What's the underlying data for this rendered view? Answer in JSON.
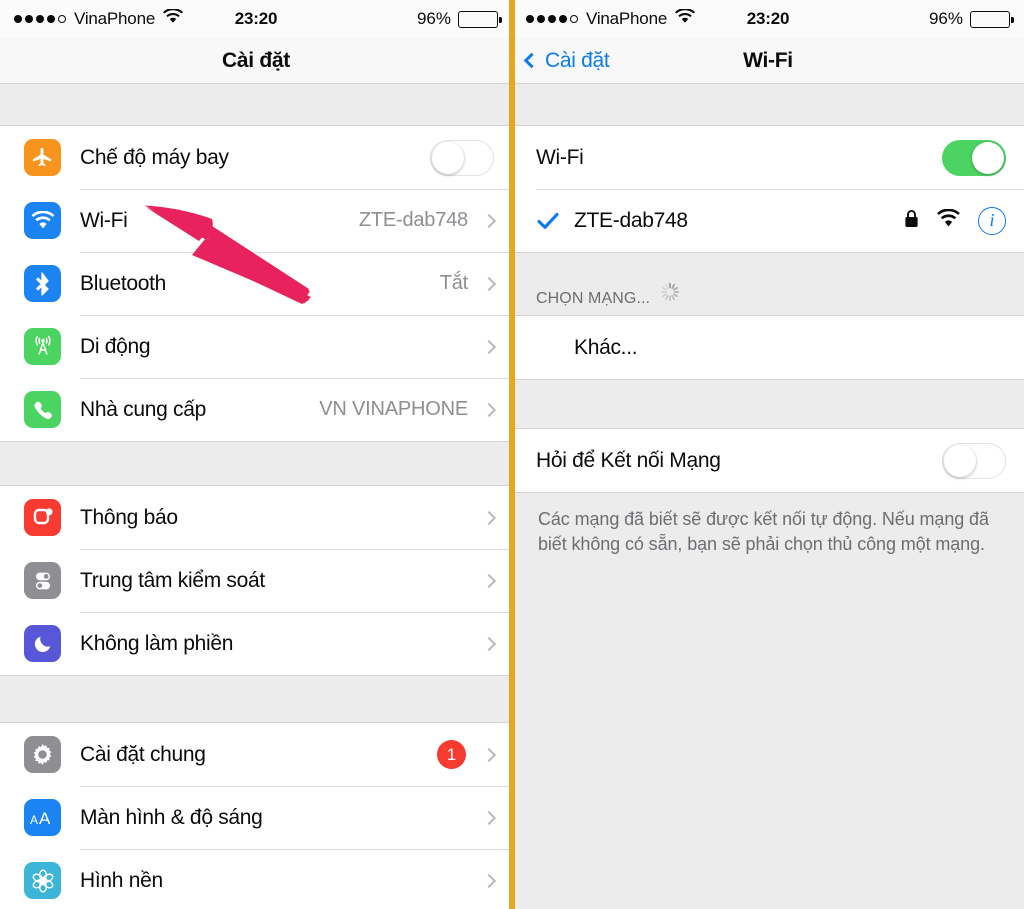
{
  "status_bar": {
    "signal_dots_filled": 4,
    "signal_dots_total": 5,
    "carrier": "VinaPhone",
    "wifi_icon": "wifi-icon",
    "time": "23:20",
    "battery_percent": "96%",
    "battery_level": 96
  },
  "left_panel": {
    "nav": {
      "title": "Cài đặt"
    },
    "groups": [
      {
        "rows": [
          {
            "label": "Chế độ máy bay",
            "icon": "airplane-icon",
            "icon_color": "#f7941d",
            "accessory": "toggle",
            "toggle_on": false
          },
          {
            "label": "Wi-Fi",
            "icon": "wifi-icon",
            "icon_color": "#1b84f2",
            "accessory": "value-chevron",
            "value": "ZTE-dab748"
          },
          {
            "label": "Bluetooth",
            "icon": "bluetooth-icon",
            "icon_color": "#1b84f2",
            "accessory": "value-chevron",
            "value": "Tắt"
          },
          {
            "label": "Di động",
            "icon": "cellular-antenna-icon",
            "icon_color": "#4cd462",
            "accessory": "chevron",
            "value": ""
          },
          {
            "label": "Nhà cung cấp",
            "icon": "phone-icon",
            "icon_color": "#4cd462",
            "accessory": "value-chevron",
            "value": "VN VINAPHONE"
          }
        ]
      },
      {
        "rows": [
          {
            "label": "Thông báo",
            "icon": "notifications-icon",
            "icon_color": "#f73b30",
            "accessory": "chevron",
            "value": ""
          },
          {
            "label": "Trung tâm kiểm soát",
            "icon": "control-center-icon",
            "icon_color": "#8e8e93",
            "accessory": "chevron",
            "value": ""
          },
          {
            "label": "Không làm phiền",
            "icon": "moon-icon",
            "icon_color": "#5757d8",
            "accessory": "chevron",
            "value": ""
          }
        ]
      },
      {
        "rows": [
          {
            "label": "Cài đặt chung",
            "icon": "gear-icon",
            "icon_color": "#8e8e93",
            "accessory": "badge-chevron",
            "badge": "1"
          },
          {
            "label": "Màn hình & độ sáng",
            "icon": "text-size-aa-icon",
            "icon_color": "#1b84f2",
            "accessory": "chevron",
            "value": ""
          },
          {
            "label": "Hình nền",
            "icon": "wallpaper-flower-icon",
            "icon_color": "#3db5d8",
            "accessory": "chevron",
            "value": ""
          }
        ]
      }
    ],
    "annotation": {
      "type": "arrow",
      "color": "#e8225c",
      "points_to": "Wi-Fi"
    }
  },
  "right_panel": {
    "nav": {
      "back_label": "Cài đặt",
      "title": "Wi-Fi"
    },
    "wifi_toggle_row": {
      "label": "Wi-Fi",
      "toggle_on": true
    },
    "connected_network": {
      "ssid": "ZTE-dab748",
      "checked": true,
      "lock_icon": "lock-icon",
      "signal_icon": "wifi-signal-icon",
      "info_icon": "info-icon"
    },
    "section_header": {
      "text": "CHỌN MẠNG...",
      "spinner": "activity-spinner-icon"
    },
    "other_row": {
      "label": "Khác..."
    },
    "ask_to_join": {
      "label": "Hỏi để Kết nối Mạng",
      "toggle_on": false
    },
    "footer_note": "Các mạng đã biết sẽ được kết nối tự động. Nếu mạng đã biết không có sẵn, bạn sẽ phải chọn thủ công một mạng."
  },
  "colors": {
    "accent_blue": "#0b7bf2",
    "toggle_green": "#4cd462",
    "badge_red": "#f73b30",
    "divider_gold": "#e8a81c",
    "arrow_pink": "#e8225c",
    "group_bg": "#ececed"
  }
}
